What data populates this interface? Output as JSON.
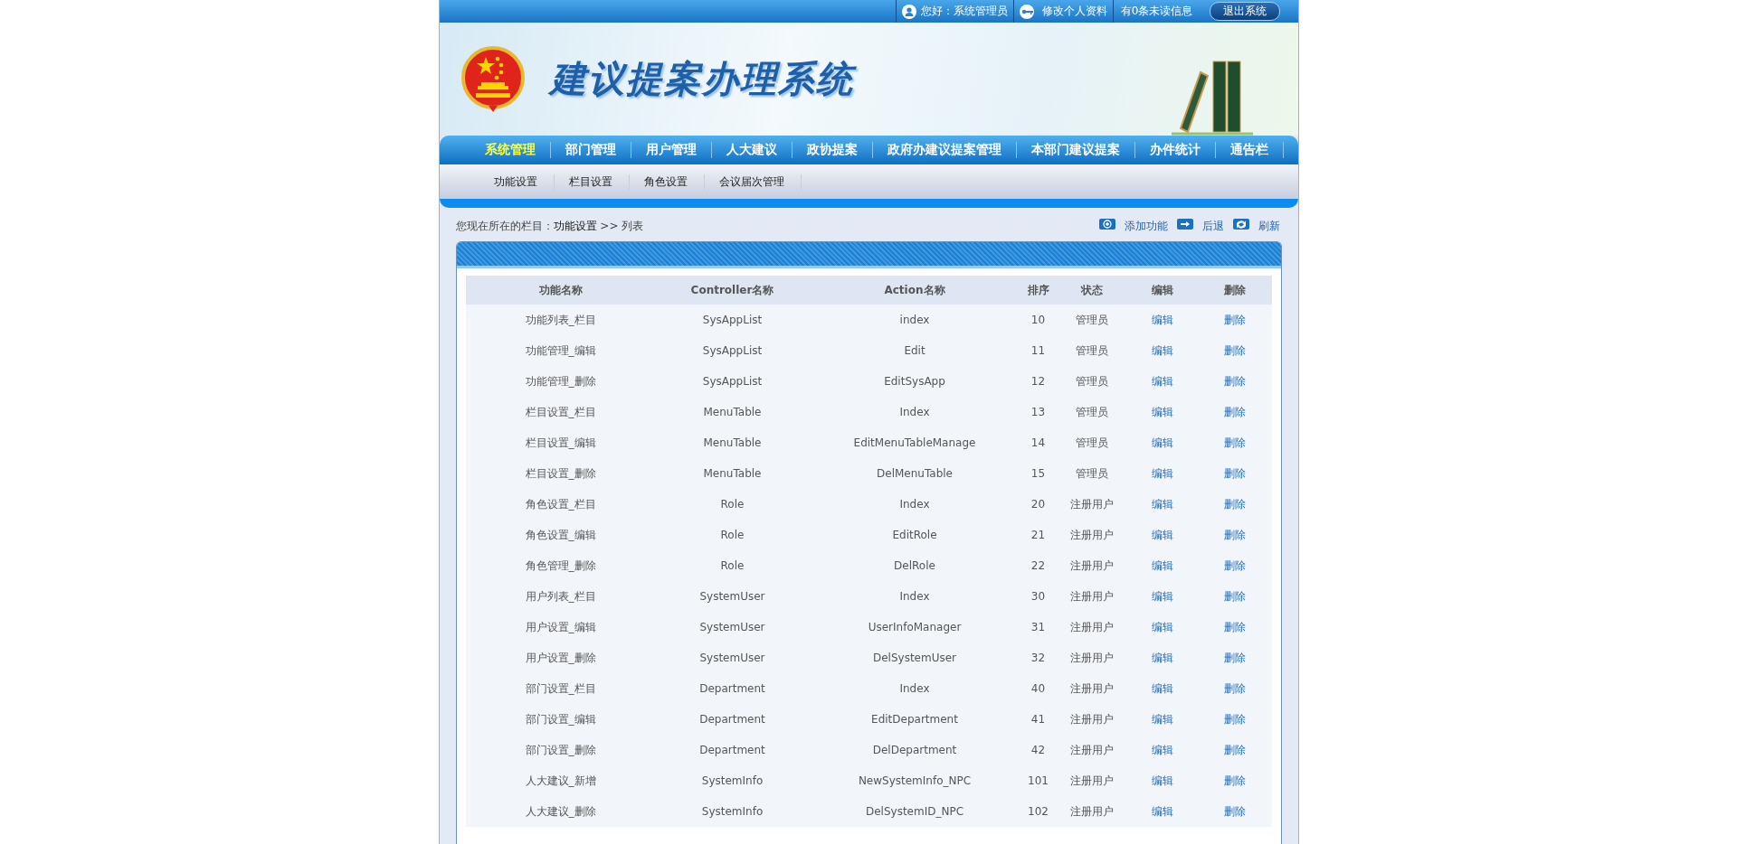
{
  "top_bar": {
    "greeting": "您好：系统管理员",
    "profile_link": "修改个人资料",
    "messages": "有0条未读信息",
    "logout": "退出系统"
  },
  "site_title": "建议提案办理系统",
  "nav": [
    {
      "label": "系统管理",
      "selected": true
    },
    {
      "label": "部门管理",
      "selected": false
    },
    {
      "label": "用户管理",
      "selected": false
    },
    {
      "label": "人大建议",
      "selected": false
    },
    {
      "label": "政协提案",
      "selected": false
    },
    {
      "label": "政府办建议提案管理",
      "selected": false
    },
    {
      "label": "本部门建议提案",
      "selected": false
    },
    {
      "label": "办件统计",
      "selected": false
    },
    {
      "label": "通告栏",
      "selected": false
    }
  ],
  "subnav": [
    "功能设置",
    "栏目设置",
    "角色设置",
    "会议届次管理"
  ],
  "breadcrumb": {
    "prefix": "您现在所在的栏目：",
    "current": "功能设置",
    "separator": ">>",
    "page": "列表"
  },
  "actions": [
    {
      "kind": "add",
      "label": "添加功能"
    },
    {
      "kind": "back",
      "label": "后退"
    },
    {
      "kind": "refresh",
      "label": "刷新"
    }
  ],
  "table": {
    "columns": [
      "功能名称",
      "Controller名称",
      "Action名称",
      "排序",
      "状态",
      "编辑",
      "删除"
    ],
    "rows": [
      [
        "功能列表_栏目",
        "SysAppList",
        "index",
        "10",
        "管理员",
        "编辑",
        "删除"
      ],
      [
        "功能管理_编辑",
        "SysAppList",
        "Edit",
        "11",
        "管理员",
        "编辑",
        "删除"
      ],
      [
        "功能管理_删除",
        "SysAppList",
        "EditSysApp",
        "12",
        "管理员",
        "编辑",
        "删除"
      ],
      [
        "栏目设置_栏目",
        "MenuTable",
        "Index",
        "13",
        "管理员",
        "编辑",
        "删除"
      ],
      [
        "栏目设置_编辑",
        "MenuTable",
        "EditMenuTableManage",
        "14",
        "管理员",
        "编辑",
        "删除"
      ],
      [
        "栏目设置_删除",
        "MenuTable",
        "DelMenuTable",
        "15",
        "管理员",
        "编辑",
        "删除"
      ],
      [
        "角色设置_栏目",
        "Role",
        "Index",
        "20",
        "注册用户",
        "编辑",
        "删除"
      ],
      [
        "角色设置_编辑",
        "Role",
        "EditRole",
        "21",
        "注册用户",
        "编辑",
        "删除"
      ],
      [
        "角色管理_删除",
        "Role",
        "DelRole",
        "22",
        "注册用户",
        "编辑",
        "删除"
      ],
      [
        "用户列表_栏目",
        "SystemUser",
        "Index",
        "30",
        "注册用户",
        "编辑",
        "删除"
      ],
      [
        "用户设置_编辑",
        "SystemUser",
        "UserInfoManager",
        "31",
        "注册用户",
        "编辑",
        "删除"
      ],
      [
        "用户设置_删除",
        "SystemUser",
        "DelSystemUser",
        "32",
        "注册用户",
        "编辑",
        "删除"
      ],
      [
        "部门设置_栏目",
        "Department",
        "Index",
        "40",
        "注册用户",
        "编辑",
        "删除"
      ],
      [
        "部门设置_编辑",
        "Department",
        "EditDepartment",
        "41",
        "注册用户",
        "编辑",
        "删除"
      ],
      [
        "部门设置_删除",
        "Department",
        "DelDepartment",
        "42",
        "注册用户",
        "编辑",
        "删除"
      ],
      [
        "人大建议_新增",
        "SystemInfo",
        "NewSystemInfo_NPC",
        "101",
        "注册用户",
        "编辑",
        "删除"
      ],
      [
        "人大建议_删除",
        "SystemInfo",
        "DelSystemID_NPC",
        "102",
        "注册用户",
        "编辑",
        "删除"
      ]
    ]
  }
}
